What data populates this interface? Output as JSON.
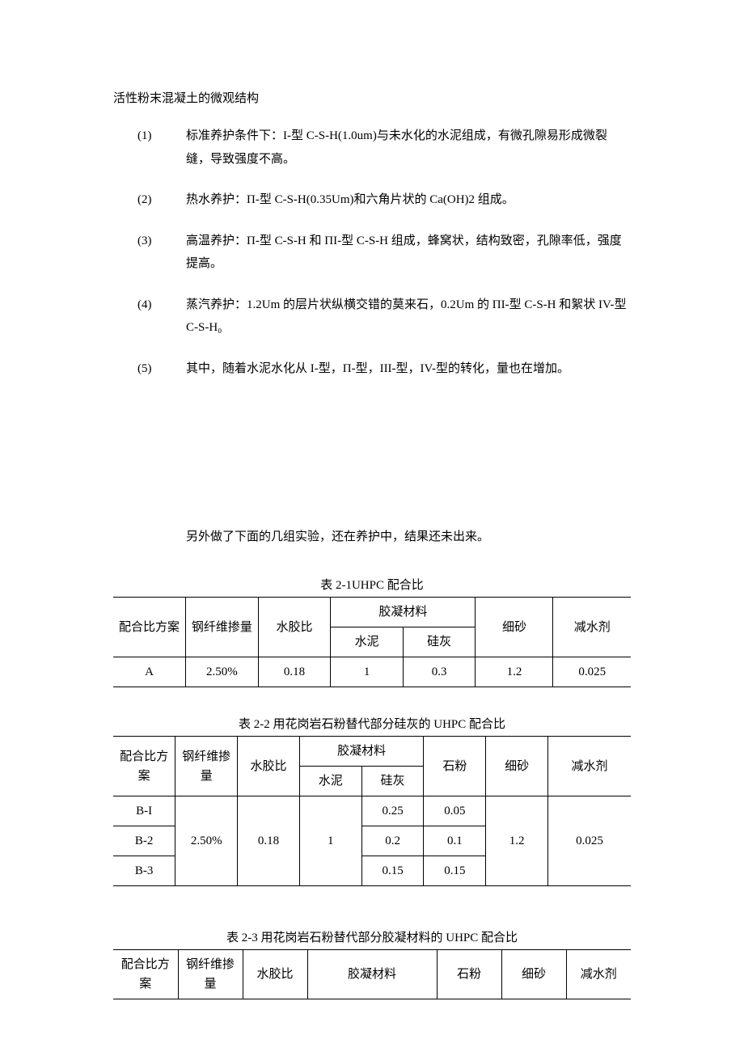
{
  "section": {
    "title": "活性粉末混凝土的微观结构",
    "items": [
      {
        "num": "(1)",
        "text": "标准养护条件下：I-型 C-S-H(1.0um)与未水化的水泥组成，有微孔隙易形成微裂缝，导致强度不高。"
      },
      {
        "num": "(2)",
        "text": "热水养护：П-型 C-S-H(0.35Um)和六角片状的 Ca(OH)2 组成。"
      },
      {
        "num": "(3)",
        "text": "高温养护：П-型 C-S-H 和 ПI-型 C-S-H 组成，蜂窝状，结构致密，孔隙率低，强度提高。"
      },
      {
        "num": "(4)",
        "text": "蒸汽养护：1.2Um 的层片状纵横交错的莫来石，0.2Um 的 ПI-型 C-S-H 和絮状 IV-型 C-S-H₀"
      },
      {
        "num": "(5)",
        "text": "其中，随着水泥水化从 I-型，П-型，III-型，IV-型的转化，量也在增加。"
      }
    ],
    "note": "另外做了下面的几组实验，还在养护中，结果还未出来。"
  },
  "headers": {
    "scheme": "配合比方案",
    "fiber": "钢纤维掺量",
    "wb": "水胶比",
    "binder": "胶凝材料",
    "cement": "水泥",
    "silica": "硅灰",
    "powder": "石粉",
    "sand": "细砂",
    "sp": "减水剂"
  },
  "table1": {
    "caption": "表 2-1UHPC 配合比",
    "rows": [
      {
        "scheme": "A",
        "fiber": "2.50%",
        "wb": "0.18",
        "cement": "1",
        "silica": "0.3",
        "sand": "1.2",
        "sp": "0.025"
      }
    ]
  },
  "table2": {
    "caption": "表 2-2 用花岗岩石粉替代部分硅灰的 UHPC 配合比",
    "shared": {
      "fiber": "2.50%",
      "wb": "0.18",
      "cement": "1",
      "sand": "1.2",
      "sp": "0.025"
    },
    "rows": [
      {
        "scheme": "B-I",
        "silica": "0.25",
        "powder": "0.05"
      },
      {
        "scheme": "B-2",
        "silica": "0.2",
        "powder": "0.1"
      },
      {
        "scheme": "B-3",
        "silica": "0.15",
        "powder": "0.15"
      }
    ]
  },
  "table3": {
    "caption": "表 2-3 用花岗岩石粉替代部分胶凝材料的 UHPC 配合比"
  }
}
